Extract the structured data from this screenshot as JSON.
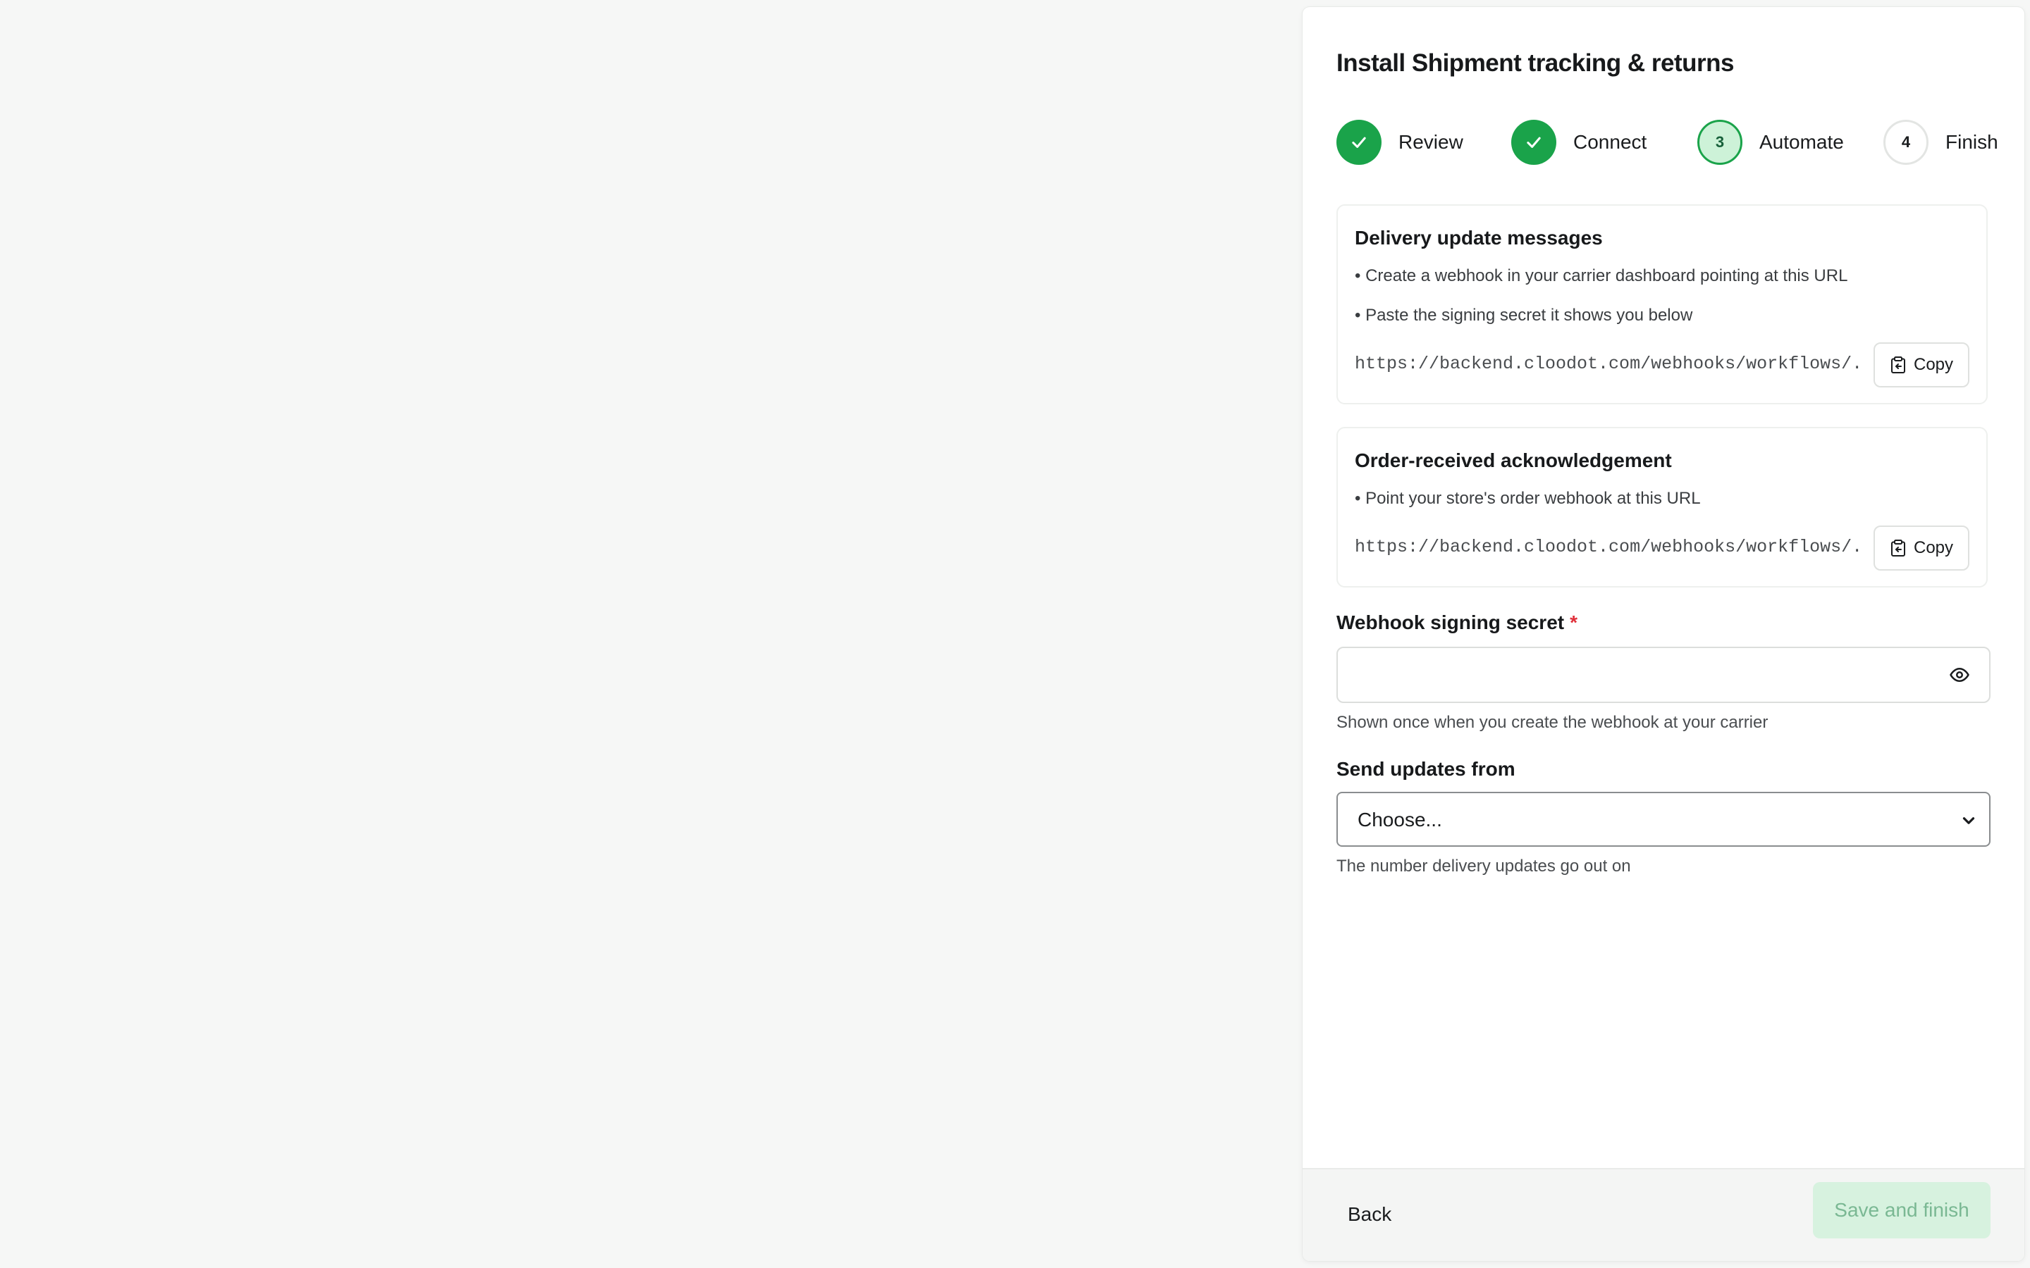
{
  "dialog": {
    "title": "Install Shipment tracking & returns"
  },
  "stepper": {
    "steps": [
      {
        "label": "Review",
        "state": "done",
        "number": "1"
      },
      {
        "label": "Connect",
        "state": "done",
        "number": "2"
      },
      {
        "label": "Automate",
        "state": "active",
        "number": "3"
      },
      {
        "label": "Finish",
        "state": "pending",
        "number": "4"
      }
    ]
  },
  "cards": [
    {
      "title": "Delivery update messages",
      "bullets": [
        "• Create a webhook in your carrier dashboard pointing at this URL",
        "• Paste the signing secret it shows you below"
      ],
      "url": "https://backend.cloodot.com/webhooks/workflows/...",
      "copy_label": "Copy"
    },
    {
      "title": "Order-received acknowledgement",
      "bullets": [
        "• Point your store's order webhook at this URL"
      ],
      "url": "https://backend.cloodot.com/webhooks/workflows/...",
      "copy_label": "Copy"
    }
  ],
  "form": {
    "secret": {
      "label": "Webhook signing secret",
      "required_mark": "*",
      "value": "",
      "help": "Shown once when you create the webhook at your carrier"
    },
    "send_from": {
      "label": "Send updates from",
      "selected": "Choose...",
      "help": "The number delivery updates go out on"
    }
  },
  "footer": {
    "back_label": "Back",
    "save_label": "Save and finish"
  },
  "colors": {
    "accent": "#1aa34a",
    "active_step_fill": "#cdf2d8",
    "disabled_button_bg": "#d7f2df",
    "disabled_button_text": "#7ab893",
    "required": "#e0303a"
  },
  "icons": {
    "step_done": "checkmark-icon",
    "copy": "clipboard-copy-icon",
    "reveal": "eye-icon",
    "select": "chevron-down-icon"
  }
}
